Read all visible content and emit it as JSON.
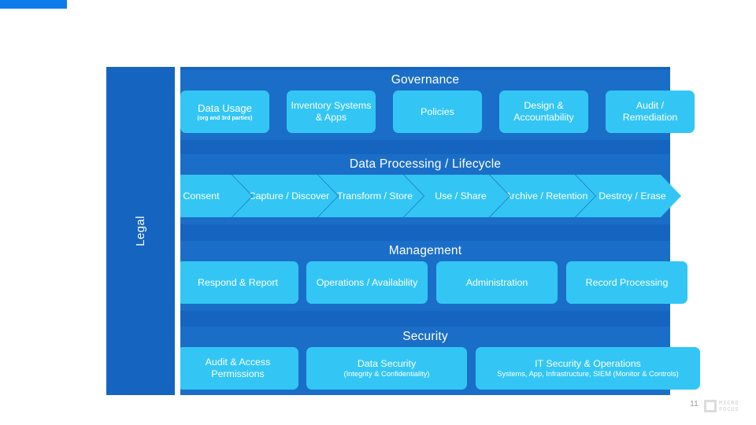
{
  "slide": {
    "page_number": "11",
    "logo": {
      "line1": "MICRO",
      "line2": "FOCUS",
      "mark": "square-logo-icon"
    }
  },
  "colors": {
    "panel_blue": "#1565C0",
    "band_blue": "#1b6ec7",
    "tile_cyan": "#33C6F4",
    "accent_bar": "#0d7ceb",
    "text": "#ffffff"
  },
  "rail": {
    "label": "Legal"
  },
  "bands": [
    {
      "id": "governance",
      "title": "Governance",
      "tiles": [
        {
          "main": "Data Usage",
          "sub": "(org and 3rd parties)"
        },
        {
          "main": "Inventory Systems & Apps",
          "sub": ""
        },
        {
          "main": "Policies",
          "sub": ""
        },
        {
          "main": "Design & Accountability",
          "sub": ""
        },
        {
          "main": "Audit / Remediation",
          "sub": ""
        }
      ]
    },
    {
      "id": "lifecycle",
      "title": "Data Processing / Lifecycle",
      "tiles": [
        {
          "main": "Consent",
          "sub": ""
        },
        {
          "main": "Capture / Discover",
          "sub": ""
        },
        {
          "main": "Transform / Store",
          "sub": ""
        },
        {
          "main": "Use / Share",
          "sub": ""
        },
        {
          "main": "Archive / Retention",
          "sub": ""
        },
        {
          "main": "Destroy / Erase",
          "sub": ""
        }
      ]
    },
    {
      "id": "management",
      "title": "Management",
      "tiles": [
        {
          "main": "Respond & Report",
          "sub": ""
        },
        {
          "main": "Operations / Availability",
          "sub": ""
        },
        {
          "main": "Administration",
          "sub": ""
        },
        {
          "main": "Record Processing",
          "sub": ""
        }
      ]
    },
    {
      "id": "security",
      "title": "Security",
      "tiles": [
        {
          "main": "Audit & Access Permissions",
          "sub": ""
        },
        {
          "main": "Data Security",
          "sub": "(Integrity & Confidentiality)"
        },
        {
          "main": "IT Security & Operations",
          "sub": "Systems, App, Infrastructure, SIEM (Monitor & Controls)"
        }
      ]
    }
  ]
}
